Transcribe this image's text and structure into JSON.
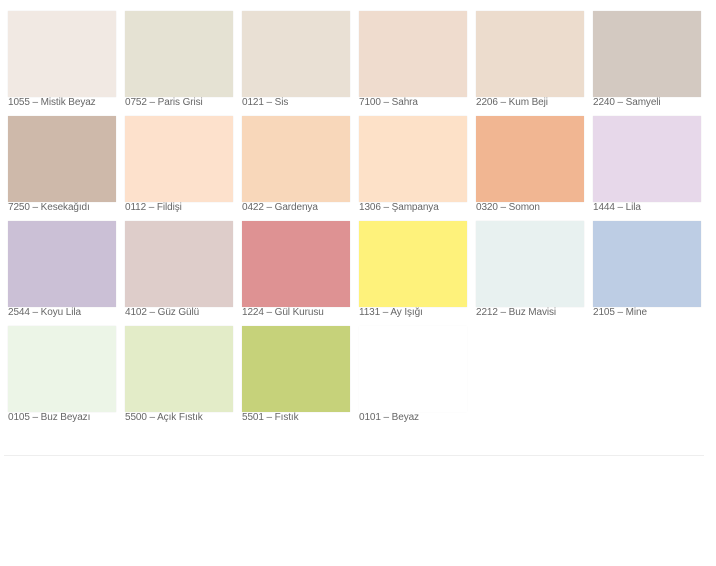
{
  "swatches": [
    {
      "label": "1055 – Mistik Beyaz",
      "color": "#f1e9e3"
    },
    {
      "label": "0752 – Paris Grisi",
      "color": "#e5e2d3"
    },
    {
      "label": "0121 – Sis",
      "color": "#e9e0d4"
    },
    {
      "label": "7100 – Sahra",
      "color": "#efdcce"
    },
    {
      "label": "2206 – Kum Beji",
      "color": "#ecdccd"
    },
    {
      "label": "2240 – Samyeli",
      "color": "#d3c9c1"
    },
    {
      "label": "7250 – Kesekağıdı",
      "color": "#ceb9aa"
    },
    {
      "label": "0112 – Fildişi",
      "color": "#fde1cc"
    },
    {
      "label": "0422 – Gardenya",
      "color": "#f8d7ba"
    },
    {
      "label": "1306 – Şampanya",
      "color": "#fde1c8"
    },
    {
      "label": "0320 – Somon",
      "color": "#f1b692"
    },
    {
      "label": "1444 – Lila",
      "color": "#e7d8ea"
    },
    {
      "label": "2544 – Koyu Lila",
      "color": "#cbc0d6"
    },
    {
      "label": "4102 – Güz Gülü",
      "color": "#decdca"
    },
    {
      "label": "1224 – Gül Kurusu",
      "color": "#de9293"
    },
    {
      "label": "1131 – Ay Işığı",
      "color": "#fef27b"
    },
    {
      "label": "2212 – Buz Mavisi",
      "color": "#e8f1f0"
    },
    {
      "label": "2105 – Mine",
      "color": "#bdcde4"
    },
    {
      "label": "0105 – Buz Beyazı",
      "color": "#ecf5e7"
    },
    {
      "label": "5500 – Açık Fıstık",
      "color": "#e3ecc8"
    },
    {
      "label": "5501 – Fıstık",
      "color": "#c6d27a"
    },
    {
      "label": "0101 – Beyaz",
      "color": "#ffffff"
    }
  ]
}
